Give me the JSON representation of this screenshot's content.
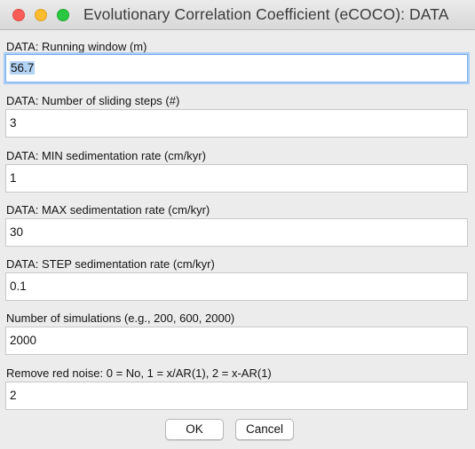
{
  "window": {
    "title": "Evolutionary Correlation Coefficient (eCOCO): DATA"
  },
  "fields": [
    {
      "label": "DATA: Running window (m)",
      "value": "56.7"
    },
    {
      "label": "DATA: Number of sliding steps (#)",
      "value": "3"
    },
    {
      "label": "DATA: MIN  sedimentation rate (cm/kyr)",
      "value": "1"
    },
    {
      "label": "DATA: MAX  sedimentation rate (cm/kyr)",
      "value": "30"
    },
    {
      "label": "DATA: STEP sedimentation rate (cm/kyr)",
      "value": "0.1"
    },
    {
      "label": "Number of simulations (e.g., 200, 600, 2000)",
      "value": "2000"
    },
    {
      "label": "Remove red noise: 0 = No, 1 = x/AR(1), 2 = x-AR(1)",
      "value": "2"
    }
  ],
  "buttons": {
    "ok_label": "OK",
    "cancel_label": "Cancel"
  },
  "colors": {
    "focus_ring": "#a9cdf5",
    "selection": "#b3d3f5",
    "close": "#fc5f57",
    "minimize": "#fdbc2e",
    "maximize": "#29c840"
  }
}
